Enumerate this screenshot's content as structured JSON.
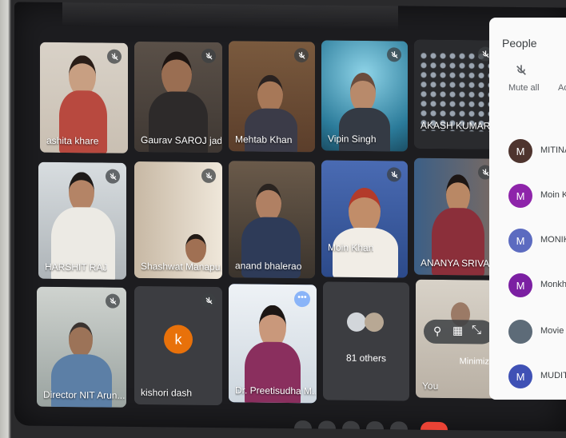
{
  "tiles": [
    {
      "name": "ashita khare"
    },
    {
      "name": "Gaurav SAROJ jad..."
    },
    {
      "name": "Mehtab Khan"
    },
    {
      "name": "Vipin Singh"
    },
    {
      "name": "AKASH KUMAR G"
    },
    {
      "name": "HARSHIT RAJ"
    },
    {
      "name": "Shashwat Manapu..."
    },
    {
      "name": "anand bhalerao"
    },
    {
      "name": "Moin Khan"
    },
    {
      "name": "ANANYA SRIVAST..."
    },
    {
      "name": "Director NIT Arun..."
    },
    {
      "name": "kishori dash",
      "avatar": "k"
    },
    {
      "name": "Dr. Preetisudha M..."
    },
    {
      "name": "81 others"
    },
    {
      "name": "You",
      "action": "Minimize"
    }
  ],
  "people_panel": {
    "title": "People",
    "mute_all": "Mute all",
    "add": "Ad",
    "participants": [
      {
        "initial": "M",
        "name": "MITINAM SI",
        "color": "#4e342e"
      },
      {
        "initial": "M",
        "name": "Moin Khan",
        "color": "#8e24aa"
      },
      {
        "initial": "M",
        "name": "MONIKA",
        "color": "#5c6bc0"
      },
      {
        "initial": "M",
        "name": "Monkhu",
        "color": "#7b1fa2"
      },
      {
        "initial": "",
        "name": "Movie [",
        "color": "#5d6b78"
      },
      {
        "initial": "M",
        "name": "MUDIT",
        "color": "#3f51b5"
      }
    ]
  },
  "colors": {
    "accent": "#8ab4f8",
    "avatar_orange": "#e8710a"
  }
}
